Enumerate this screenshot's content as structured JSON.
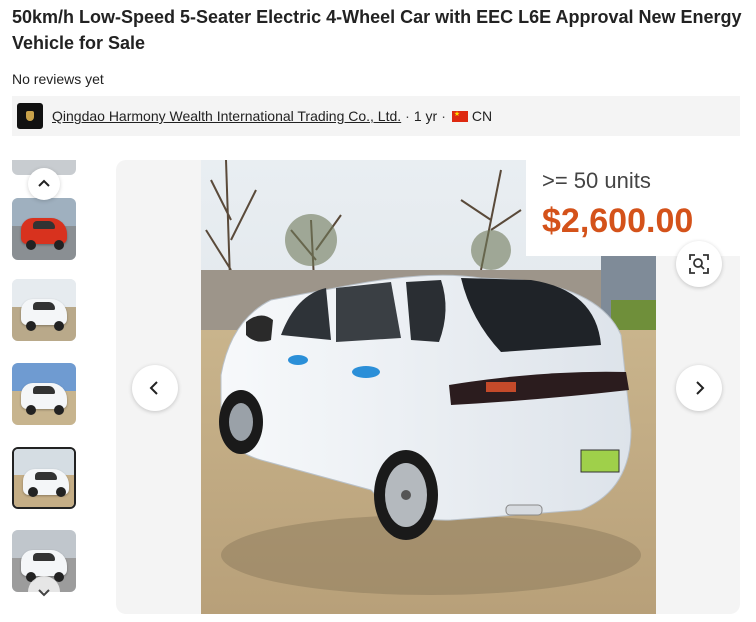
{
  "product": {
    "title": "50km/h Low-Speed 5-Seater Electric 4-Wheel Car with EEC L6E Approval New Energy Vehicle for Sale",
    "reviews": "No reviews yet"
  },
  "supplier": {
    "name": "Qingdao Harmony Wealth International Trading Co., Ltd.",
    "years": "1 yr",
    "country": "CN",
    "separator": "·"
  },
  "pricing": {
    "quantity": ">= 50 units",
    "price": "$2,600.00",
    "accent_color": "#d4521a"
  },
  "gallery": {
    "thumbnail_count": 6,
    "active_thumbnail": 4,
    "icons": {
      "thumb_up": "chevron-up-icon",
      "thumb_down": "chevron-down-icon",
      "prev": "chevron-left-icon",
      "next": "chevron-right-icon",
      "image_search": "image-search-icon"
    }
  }
}
